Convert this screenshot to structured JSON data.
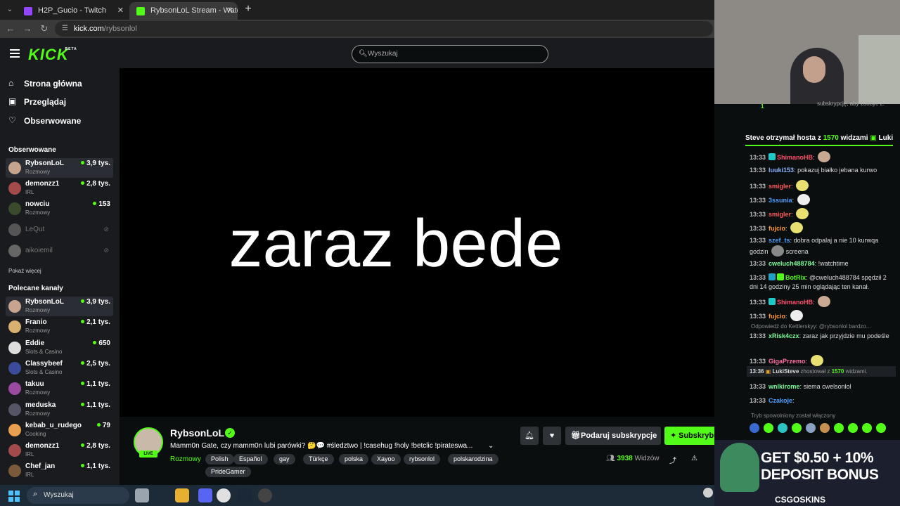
{
  "browser": {
    "tabs": [
      {
        "label": "H2P_Gucio - Twitch"
      },
      {
        "label": "RybsonLoL Stream - Watch Live"
      }
    ],
    "url_domain": "kick.com",
    "url_path": "/rybsonlol"
  },
  "header": {
    "logo": "KICK",
    "logo_badge": "BETA",
    "search_placeholder": "Wyszukaj"
  },
  "sidebar": {
    "nav": [
      {
        "label": "Strona główna",
        "icon": "home-icon"
      },
      {
        "label": "Przeglądaj",
        "icon": "browse-icon"
      },
      {
        "label": "Obserwowane",
        "icon": "heart-icon"
      }
    ],
    "followed_title": "Obserwowane",
    "followed": [
      {
        "name": "RybsonLoL",
        "category": "Rozmowy",
        "viewers": "3,9 tys."
      },
      {
        "name": "demonzz1",
        "category": "IRL",
        "viewers": "2,8 tys."
      },
      {
        "name": "nowciu",
        "category": "Rozmowy",
        "viewers": "153"
      },
      {
        "name": "LeQut"
      },
      {
        "name": "aikoiemil"
      }
    ],
    "show_more": "Pokaż więcej",
    "recommended_title": "Polecane kanały",
    "recommended": [
      {
        "name": "RybsonLoL",
        "category": "Rozmowy",
        "viewers": "3,9 tys."
      },
      {
        "name": "Franio",
        "category": "Rozmowy",
        "viewers": "2,1 tys."
      },
      {
        "name": "Eddie",
        "category": "Slots & Casino",
        "viewers": "650"
      },
      {
        "name": "Classybeef",
        "category": "Slots & Casino",
        "viewers": "2,5 tys."
      },
      {
        "name": "takuu",
        "category": "Rozmowy",
        "viewers": "1,1 tys."
      },
      {
        "name": "meduska",
        "category": "Rozmowy",
        "viewers": "1,1 tys."
      },
      {
        "name": "kebab_u_rudego",
        "category": "Cooking",
        "viewers": "79"
      },
      {
        "name": "demonzz1",
        "category": "IRL",
        "viewers": "2,8 tys."
      },
      {
        "name": "Chef_jan",
        "category": "IRL",
        "viewers": "1,1 tys."
      }
    ]
  },
  "video": {
    "overlay_text": "zaraz bede"
  },
  "stream": {
    "live_label": "LIVE",
    "streamer": "RybsonLoL",
    "title": "Mamm0n Gate, czy mamm0n lubi parówki? 🤔💬 #śledztwo | !casehug !holy !betclic !pirateswa...",
    "category": "Rozmowy",
    "tags": [
      "Polish",
      "Español",
      "gay",
      "Türkçe",
      "polska",
      "Xayoo",
      "rybsonlol",
      "polskarodzina",
      "PrideGamer"
    ],
    "gift_label": "Podaruj subskrypcje",
    "subscribe_label": "Subskrybuj",
    "viewers_count": "3938",
    "viewers_label": "Widzów"
  },
  "chat": {
    "sub_info": "subskrypcję, aby zdobyć 2.",
    "pinned": {
      "prefix": "Steve otrzymał hosta z",
      "count": "1570",
      "suffix": "widzami",
      "next": "LukiS"
    },
    "messages": [
      {
        "time": "13:33",
        "user": "ShimanoHB",
        "color": "#ff4d6d",
        "text": ""
      },
      {
        "time": "13:33",
        "user": "luuki153",
        "color": "#8ab4ff",
        "text": "pokazuj białko jebana kurwo"
      },
      {
        "time": "13:33",
        "user": "smigler",
        "color": "#ff5c5c",
        "text": ""
      },
      {
        "time": "13:33",
        "user": "3ssunia",
        "color": "#4ea1ff",
        "text": ""
      },
      {
        "time": "13:33",
        "user": "smigler",
        "color": "#ff5c5c",
        "text": ""
      },
      {
        "time": "13:33",
        "user": "fujcio",
        "color": "#ff9a3c",
        "text": ""
      },
      {
        "time": "13:33",
        "user": "szef_ts",
        "color": "#4ea1ff",
        "text": "dobra odpalaj a nie 10 kurwqa godzin",
        "text2": "screena"
      },
      {
        "time": "13:33",
        "user": "cweluch488784",
        "color": "#7cfc9a",
        "text": "!watchtime"
      },
      {
        "time": "13:33",
        "user": "BotRix",
        "color": "#53fc18",
        "text": "@cweluch488784 spędził 2 dni 14 godziny 25 min oglądając ten kanał."
      },
      {
        "time": "13:33",
        "user": "ShimanoHB",
        "color": "#ff4d6d",
        "text": ""
      },
      {
        "time": "13:33",
        "user": "fujcio",
        "color": "#ff9a3c",
        "text": ""
      },
      {
        "time": "13:33",
        "user": "xRisk4czx",
        "color": "#7cfc9a",
        "text": "zaraz jak przyjdzie mu podeśle"
      },
      {
        "time": "13:33",
        "user": "GigaPrzemo",
        "color": "#ff6fa0",
        "text": ""
      },
      {
        "time": "13:33",
        "user": "wnlkirome",
        "color": "#7cfc9a",
        "text": "siema cwelsonlol"
      },
      {
        "time": "13:33",
        "user": "Czakoje",
        "color": "#4ea1ff",
        "text": ""
      }
    ],
    "reply_note": "Odpowiedź do Kettlerskyy: @rybsonlol bardzo...",
    "host_event": {
      "time": "13:36",
      "user": "LukiSteve",
      "text": "zhostował z",
      "count": "1570",
      "suffix": "widzami."
    },
    "slow_mode": "Tryb spowolniony został włączony"
  },
  "ad": {
    "line1": "GET $0.50 + 10%",
    "line2": "DEPOSIT BONUS",
    "brand": "CSGOSKINS"
  },
  "taskbar": {
    "search_placeholder": "Wyszukaj"
  },
  "colors": {
    "accent": "#53fc18",
    "bg": "#0b0e0f",
    "panel": "#191b1f"
  }
}
